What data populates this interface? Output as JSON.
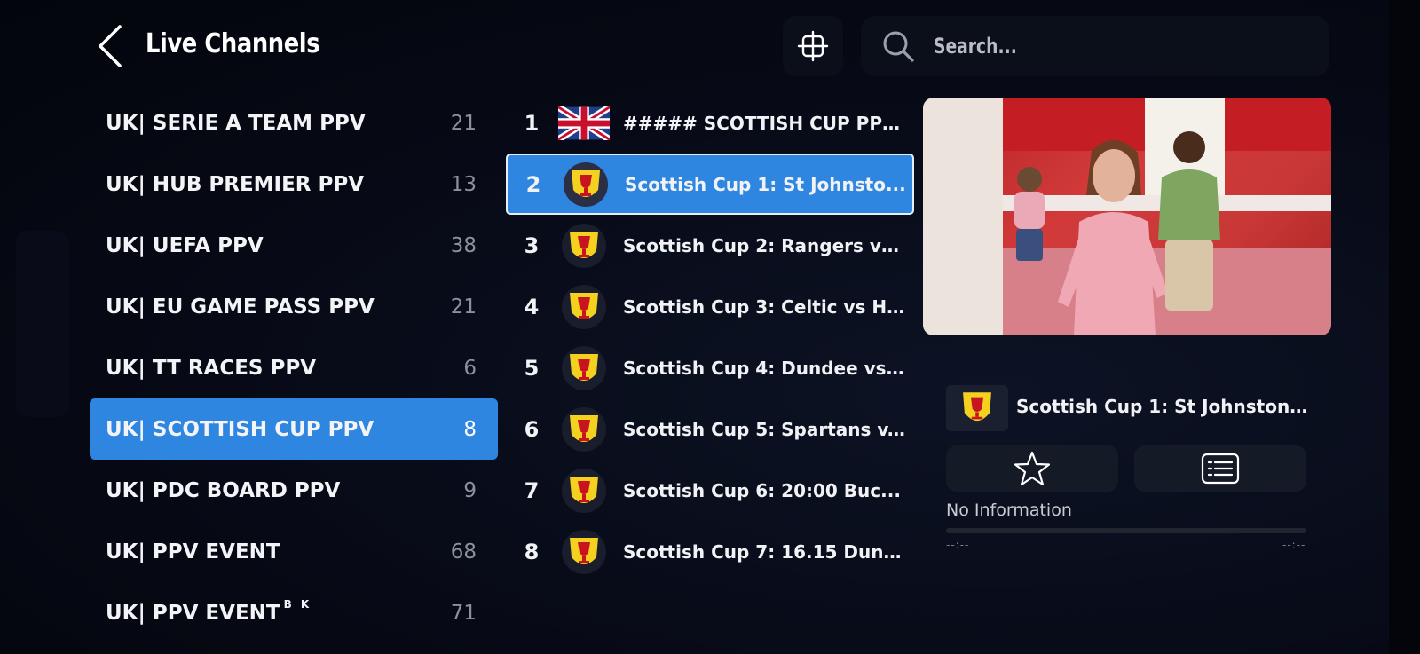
{
  "header": {
    "title": "Live Channels",
    "search_placeholder": "Search..."
  },
  "categories": [
    {
      "name": "UK| SERIE A TEAM PPV",
      "count": "21"
    },
    {
      "name": "UK| HUB PREMIER PPV",
      "count": "13"
    },
    {
      "name": "UK| UEFA PPV",
      "count": "38"
    },
    {
      "name": "UK| EU GAME PASS PPV",
      "count": "21"
    },
    {
      "name": "UK| TT RACES PPV",
      "count": "6"
    },
    {
      "name": "UK| SCOTTISH CUP PPV",
      "count": "8"
    },
    {
      "name": "UK| PDC BOARD PPV",
      "count": "9"
    },
    {
      "name": "UK| PPV EVENT",
      "count": "68"
    },
    {
      "name": "UK| PPV EVENT",
      "superscript": "B K",
      "count": "71"
    }
  ],
  "selected_category_index": 5,
  "channels": [
    {
      "number": "1",
      "name": "##### SCOTTISH CUP PPV...",
      "logo": "uk-flag-icon"
    },
    {
      "number": "2",
      "name": "Scottish Cup 1: St Johnsto...",
      "logo": "scottish-cup-trophy-icon"
    },
    {
      "number": "3",
      "name": "Scottish Cup 2: Rangers vs...",
      "logo": "scottish-cup-trophy-icon"
    },
    {
      "number": "4",
      "name": "Scottish Cup 3: Celtic vs Hi...",
      "logo": "scottish-cup-trophy-icon"
    },
    {
      "number": "5",
      "name": "Scottish Cup 4: Dundee vs...",
      "logo": "scottish-cup-trophy-icon"
    },
    {
      "number": "6",
      "name": "Scottish Cup 5: Spartans v...",
      "logo": "scottish-cup-trophy-icon"
    },
    {
      "number": "7",
      "name": "Scottish Cup 6: 20:00 Buc...",
      "logo": "scottish-cup-trophy-icon"
    },
    {
      "number": "8",
      "name": "Scottish Cup 7: 16.15 Dund...",
      "logo": "scottish-cup-trophy-icon"
    }
  ],
  "selected_channel_index": 1,
  "now_playing": {
    "title": "Scottish Cup 1: St Johnstone...",
    "info": "No Information",
    "progress": 0,
    "time_start": "--:--",
    "time_end": "--:--",
    "favorite_icon": "star-outline-icon",
    "epg_icon": "epg-guide-icon"
  },
  "colors": {
    "accent": "#2f86e0",
    "background": "#05070f",
    "panel": "#0b0f1a",
    "trophy_yellow": "#f5d11f",
    "trophy_red": "#c8141e"
  }
}
